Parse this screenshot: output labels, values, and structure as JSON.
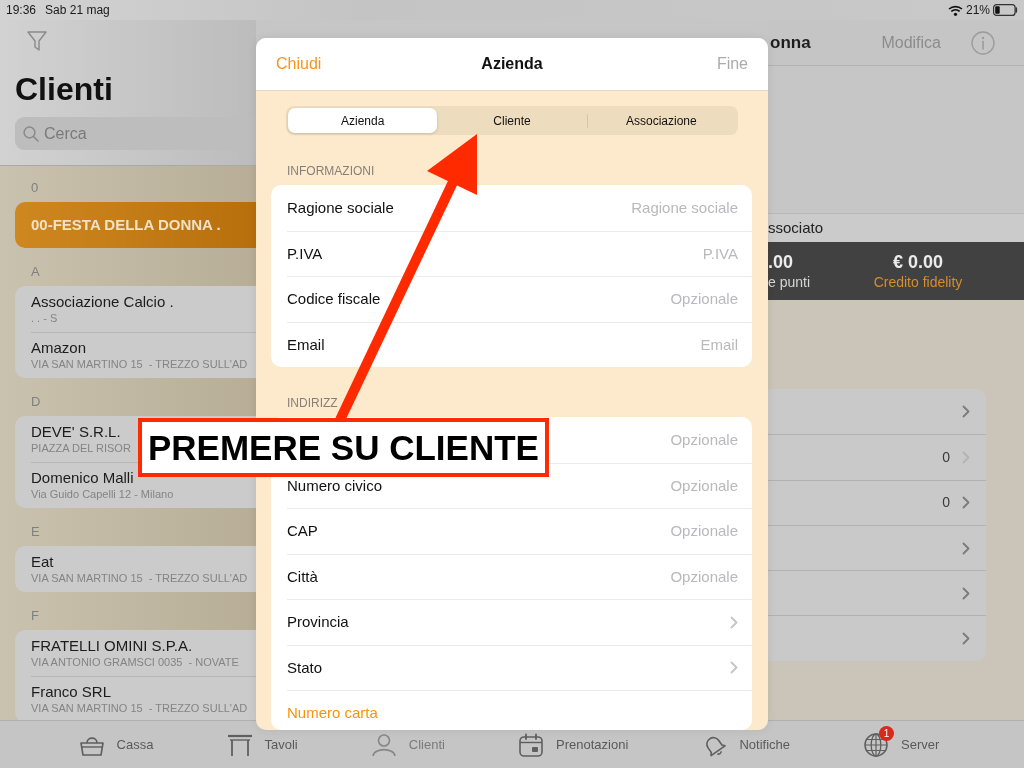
{
  "status_bar": {
    "time": "19:36",
    "date": "Sab 21 mag",
    "battery": "21%"
  },
  "sidebar": {
    "title": "Clienti",
    "search": {
      "placeholder": "Cerca"
    },
    "sections": [
      {
        "letter": "0",
        "items": [
          {
            "name": "00-FESTA DELLA DONNA .",
            "selected": true
          }
        ]
      },
      {
        "letter": "A",
        "items": [
          {
            "name": "Associazione Calcio .",
            "address": ". . - S",
            "selected": false
          },
          {
            "name": "Amazon",
            "address": "VIA SAN MARTINO 15  - TREZZO SULL'AD",
            "selected": false
          }
        ]
      },
      {
        "letter": "D",
        "items": [
          {
            "name": "DEVE' S.R.L.",
            "address": "PIAZZA DEL RISOR",
            "selected": false
          },
          {
            "name": "Domenico Malli",
            "address": "Via Guido Capelli 12 - Milano",
            "selected": false
          }
        ]
      },
      {
        "letter": "E",
        "items": [
          {
            "name": "Eat",
            "address": "VIA SAN MARTINO 15  - TREZZO SULL'AD",
            "selected": false
          }
        ]
      },
      {
        "letter": "F",
        "items": [
          {
            "name": "FRATELLI OMINI S.P.A.",
            "address": "VIA ANTONIO GRAMSCI 0035  - NOVATE",
            "selected": false
          },
          {
            "name": "Franco SRL",
            "address": "VIA SAN MARTINO 15  - TREZZO SULL'AD",
            "selected": false
          }
        ]
      }
    ]
  },
  "detail": {
    "title": "onna",
    "edit": "Modifica",
    "associated_label": "ssociato",
    "stats": [
      {
        "value": ".00",
        "label": "e punti",
        "accent": false
      },
      {
        "value": "€ 0.00",
        "label": "Credito fidelity",
        "accent": true
      }
    ],
    "rows": [
      {
        "disabled": false
      },
      {
        "count": "0",
        "disabled": true
      },
      {
        "count": "0",
        "disabled": false
      },
      {
        "disabled": false
      },
      {
        "disabled": false
      },
      {
        "disabled": false
      }
    ]
  },
  "modal": {
    "close": "Chiudi",
    "title": "Azienda",
    "done": "Fine",
    "done_disabled": true,
    "segments": [
      {
        "label": "Azienda",
        "selected": true
      },
      {
        "label": "Cliente",
        "selected": false
      },
      {
        "label": "Associazione",
        "selected": false
      }
    ],
    "sections": [
      {
        "header": "INFORMAZIONI",
        "rows": [
          {
            "kind": "text",
            "label": "Ragione sociale",
            "placeholder": "Ragione sociale"
          },
          {
            "kind": "text",
            "label": "P.IVA",
            "placeholder": "P.IVA"
          },
          {
            "kind": "text",
            "label": "Codice fiscale",
            "placeholder": "Opzionale"
          },
          {
            "kind": "text",
            "label": "Email",
            "placeholder": "Email"
          }
        ]
      },
      {
        "header": "INDIRIZZ",
        "rows": [
          {
            "kind": "text",
            "placeholder": "Opzionale"
          },
          {
            "kind": "text",
            "label": "Numero civico",
            "placeholder": "Opzionale"
          },
          {
            "kind": "text",
            "label": "CAP",
            "placeholder": "Opzionale"
          },
          {
            "kind": "text",
            "label": "Città",
            "placeholder": "Opzionale"
          },
          {
            "kind": "picker",
            "label": "Provincia"
          },
          {
            "kind": "picker",
            "label": "Stato"
          },
          {
            "kind": "action",
            "label": "Numero carta"
          }
        ]
      }
    ]
  },
  "tab_bar": [
    {
      "label": "Cassa",
      "selected": false
    },
    {
      "label": "Tavoli",
      "selected": false
    },
    {
      "label": "Clienti",
      "selected": true
    },
    {
      "label": "Prenotazioni",
      "selected": false
    },
    {
      "label": "Notifiche",
      "selected": false
    },
    {
      "label": "Server",
      "selected": false,
      "badge": "1"
    }
  ],
  "annotation": {
    "text": "PREMERE SU CLIENTE"
  }
}
